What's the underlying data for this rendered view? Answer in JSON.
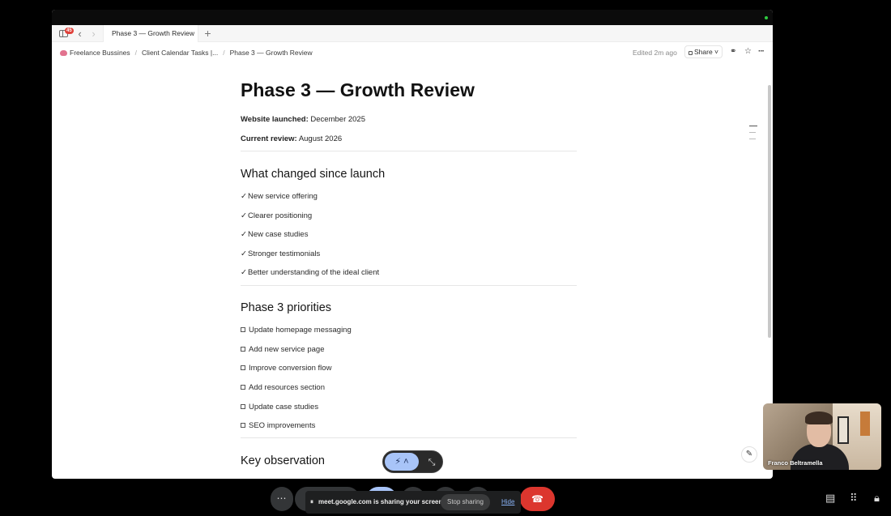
{
  "browser": {
    "tab_title": "Phase 3 — Growth Review",
    "notification_count": "45",
    "breadcrumbs": [
      "Freelance Bussines",
      "Client Calendar Tasks |...",
      "Phase 3 — Growth Review"
    ],
    "edited": "Edited 2m ago",
    "share_label": "Share"
  },
  "doc": {
    "title": "Phase 3 — Growth Review",
    "meta": [
      {
        "label": "Website launched:",
        "value": "December 2025"
      },
      {
        "label": "Current review:",
        "value": "August 2026"
      }
    ],
    "section1": {
      "heading": "What changed since launch",
      "items": [
        "New service offering",
        "Clearer positioning",
        "New case studies",
        "Stronger testimonials",
        "Better understanding of the ideal client"
      ]
    },
    "section2": {
      "heading": "Phase 3 priorities",
      "items": [
        "Update homepage messaging",
        "Add new service page",
        "Improve conversion flow",
        "Add resources section",
        "Update case studies",
        "SEO improvements"
      ]
    },
    "section3": {
      "heading": "Key observation"
    }
  },
  "meet": {
    "sharing_message": "meet.google.com is sharing your screen.",
    "stop_label": "Stop sharing",
    "hide_label": "Hide",
    "participant_name": "Franco Beltramella"
  },
  "icons": {
    "check": "✓",
    "accent_red": "#dc362e",
    "accent_blue": "#a8c4f8"
  }
}
